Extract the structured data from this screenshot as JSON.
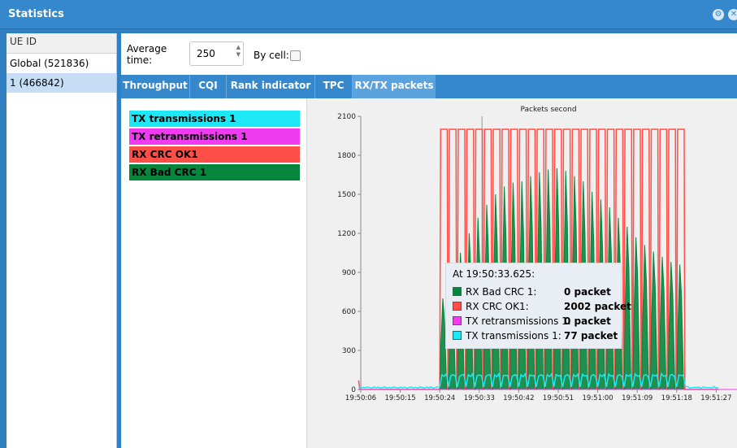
{
  "window": {
    "title": "Statistics",
    "colors": {
      "titlebar": "#3588cc",
      "accent": "#5aa3de"
    }
  },
  "ue_list": {
    "header": "UE ID",
    "rows": [
      {
        "label": "Global (521836)"
      },
      {
        "label": "1 (466842)"
      }
    ]
  },
  "toolbar": {
    "average_label_line1": "Average",
    "average_label_line2": "time:",
    "average_value": "250",
    "by_cell_label": "By cell:",
    "by_cell_checked": false
  },
  "tabs": [
    {
      "label": "Throughput"
    },
    {
      "label": "CQI"
    },
    {
      "label": "Rank indicator"
    },
    {
      "label": "TPC"
    },
    {
      "label": "RX/TX packets",
      "active": true
    }
  ],
  "legend": [
    {
      "label": "TX transmissions 1",
      "color": "#1ee8f5"
    },
    {
      "label": "TX retransmissions 1",
      "color": "#f03cf0"
    },
    {
      "label": "RX CRC OK1",
      "color": "#ff4f48"
    },
    {
      "label": "RX Bad CRC 1",
      "color": "#07853d"
    }
  ],
  "tooltip": {
    "time": "At 19:50:33.625:",
    "rows": [
      {
        "label": "RX Bad CRC 1:",
        "value": "0 packet",
        "color": "#07853d"
      },
      {
        "label": "RX CRC OK1:",
        "value": "2002 packet",
        "color": "#ff4f48"
      },
      {
        "label": "TX retransmissions 1:",
        "value": "0 packet",
        "color": "#f03cf0"
      },
      {
        "label": "TX transmissions 1:",
        "value": "77 packet",
        "color": "#1ee8f5"
      }
    ]
  },
  "chart_data": {
    "type": "line",
    "title": "Packets second",
    "xlabel": "",
    "ylabel": "",
    "ylim": [
      0,
      2100
    ],
    "yticks": [
      "0",
      "300",
      "600",
      "900",
      "1200",
      "1500",
      "1800",
      "2100"
    ],
    "xticks": [
      "19:50:06",
      "19:50:15",
      "19:50:24",
      "19:50:33",
      "19:50:42",
      "19:50:51",
      "19:51:00",
      "19:51:09",
      "19:51:18",
      "19:51:27"
    ],
    "burst_start": "19:50:24",
    "burst_end": "19:51:20",
    "burst_period_s": 2,
    "series": [
      {
        "name": "RX CRC OK1",
        "color": "#ff4f48",
        "idle_value": 0,
        "peak_value": 2000,
        "trough_value": 0
      },
      {
        "name": "RX Bad CRC 1",
        "color": "#07853d",
        "burst_peaks": [
          700,
          880,
          1050,
          1200,
          1320,
          1420,
          1500,
          1560,
          1590,
          1600,
          1640,
          1670,
          1690,
          1700,
          1680,
          1640,
          1600,
          1520,
          1460,
          1400,
          1320,
          1250,
          1170,
          1110,
          1060,
          1020,
          980,
          960
        ]
      },
      {
        "name": "TX transmissions 1",
        "color": "#1ee8f5",
        "idle_value": 15,
        "burst_value": 110
      },
      {
        "name": "TX retransmissions 1",
        "color": "#f03cf0",
        "value": 0
      }
    ]
  }
}
